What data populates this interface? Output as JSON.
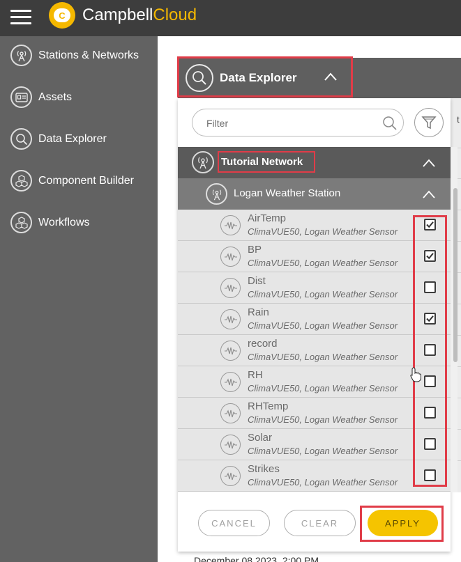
{
  "app": {
    "brand_main": "Campbell",
    "brand_accent": "Cloud",
    "logo_letter": "C",
    "accent_color": "#f5b800",
    "highlight_color": "#e03c48"
  },
  "sidebar": {
    "items": [
      {
        "label": "Stations & Networks",
        "icon": "radio-tower-icon"
      },
      {
        "label": "Assets",
        "icon": "asset-card-icon"
      },
      {
        "label": "Data Explorer",
        "icon": "search-icon"
      },
      {
        "label": "Component Builder",
        "icon": "cubes-icon"
      },
      {
        "label": "Workflows",
        "icon": "workflow-cubes-icon"
      }
    ]
  },
  "data_explorer": {
    "title": "Data Explorer",
    "filter_placeholder": "Filter",
    "network": {
      "label": "Tutorial Network"
    },
    "station": {
      "label": "Logan Weather Station"
    },
    "variables": [
      {
        "name": "AirTemp",
        "source": "ClimaVUE50, Logan Weather Sensor",
        "checked": true
      },
      {
        "name": "BP",
        "source": "ClimaVUE50, Logan Weather Sensor",
        "checked": true
      },
      {
        "name": "Dist",
        "source": "ClimaVUE50, Logan Weather Sensor",
        "checked": false
      },
      {
        "name": "Rain",
        "source": "ClimaVUE50, Logan Weather Sensor",
        "checked": true
      },
      {
        "name": "record",
        "source": "ClimaVUE50, Logan Weather Sensor",
        "checked": false
      },
      {
        "name": "RH",
        "source": "ClimaVUE50, Logan Weather Sensor",
        "checked": false
      },
      {
        "name": "RHTemp",
        "source": "ClimaVUE50, Logan Weather Sensor",
        "checked": false
      },
      {
        "name": "Solar",
        "source": "ClimaVUE50, Logan Weather Sensor",
        "checked": false
      },
      {
        "name": "Strikes",
        "source": "ClimaVUE50, Logan Weather Sensor",
        "checked": false
      }
    ],
    "buttons": {
      "cancel": "CANCEL",
      "clear": "CLEAR",
      "apply": "APPLY"
    }
  },
  "background": {
    "partial_date": "December 08 2023, 2:00 PM",
    "partial_char": "t"
  }
}
